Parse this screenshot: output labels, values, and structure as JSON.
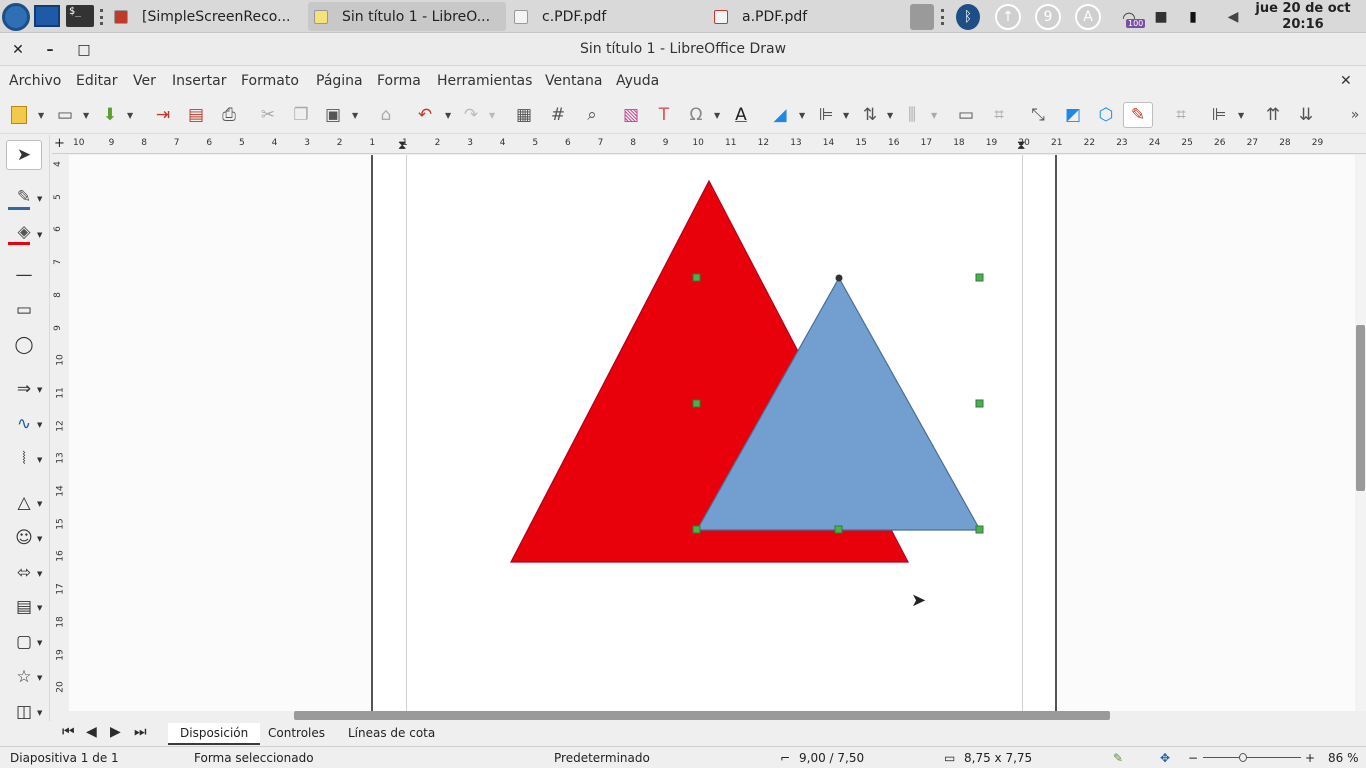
{
  "taskbar": {
    "tasks": [
      {
        "label": "[SimpleScreenReco..."
      },
      {
        "label": "Sin título 1 - LibreO..."
      },
      {
        "label": "c.PDF.pdf"
      },
      {
        "label": "a.PDF.pdf"
      }
    ],
    "tray": {
      "circle1": "9",
      "circle2": "A",
      "battery_badge": "100"
    },
    "clock": {
      "date": "jue 20 de oct",
      "time": "20:16"
    }
  },
  "window": {
    "title": "Sin título 1 - LibreOffice Draw"
  },
  "menubar": [
    "Archivo",
    "Editar",
    "Ver",
    "Insertar",
    "Formato",
    "Página",
    "Forma",
    "Herramientas",
    "Ventana",
    "Ayuda"
  ],
  "ruler": {
    "horizontal": [
      "10",
      "9",
      "8",
      "7",
      "6",
      "5",
      "4",
      "3",
      "2",
      "1",
      "1",
      "2",
      "3",
      "4",
      "5",
      "6",
      "7",
      "8",
      "9",
      "10",
      "11",
      "12",
      "13",
      "14",
      "15",
      "16",
      "17",
      "18",
      "19",
      "20",
      "21",
      "22",
      "23",
      "24",
      "25",
      "26",
      "27",
      "28",
      "29"
    ],
    "vertical": [
      "4",
      "5",
      "6",
      "7",
      "8",
      "9",
      "10",
      "11",
      "12",
      "13",
      "14",
      "15",
      "16",
      "17",
      "18",
      "19",
      "20"
    ]
  },
  "drawing": {
    "red_triangle_color": "#e8000b",
    "blue_triangle_color": "#729fcf",
    "handle_color": "#4caf50"
  },
  "tabs": [
    "Disposición",
    "Controles",
    "Líneas de cota"
  ],
  "status": {
    "slide": "Diapositiva 1 de 1",
    "selection": "Forma seleccionado",
    "master": "Predeterminado",
    "position": "9,00 / 7,50",
    "size": "8,75 x 7,75",
    "zoom": "86 %"
  }
}
